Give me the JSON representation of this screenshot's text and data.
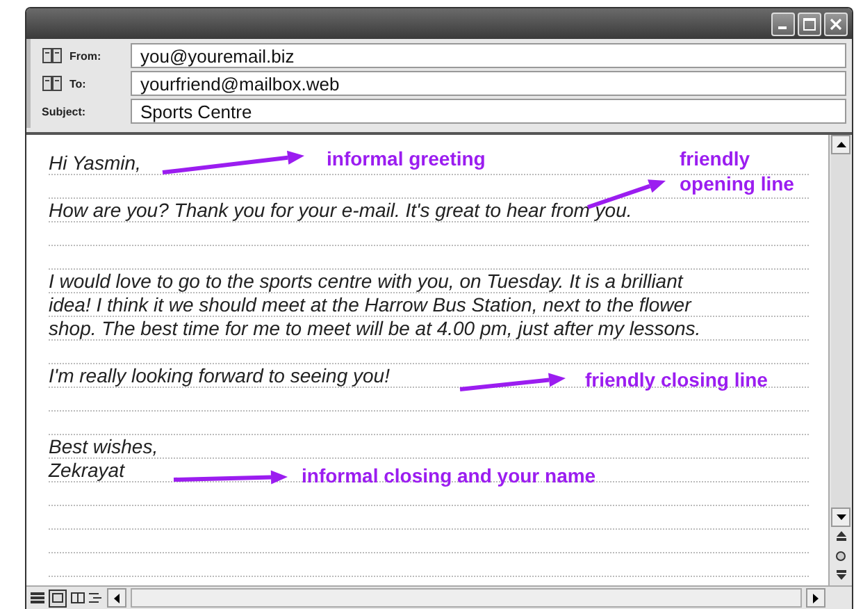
{
  "header": [
    {
      "label": "From:",
      "has_icon": true,
      "value": "you@youremail.biz"
    },
    {
      "label": "To:",
      "has_icon": true,
      "value": "yourfriend@mailbox.web"
    },
    {
      "label": "Subject:",
      "has_icon": false,
      "value": "Sports Centre"
    }
  ],
  "body_lines": [
    {
      "kind": "text",
      "text": "Hi Yasmin,"
    },
    {
      "kind": "blank"
    },
    {
      "kind": "text",
      "text": "How are you? Thank you for your e-mail. It's great to hear from you."
    },
    {
      "kind": "blank"
    },
    {
      "kind": "blank"
    },
    {
      "kind": "text",
      "text": "I would love to go to the sports centre with you, on Tuesday. It is a brilliant"
    },
    {
      "kind": "text",
      "text": "idea! I think it we should meet at the Harrow Bus Station, next to the flower"
    },
    {
      "kind": "text",
      "text": "shop. The best time for me to meet will be at 4.00 pm, just after my lessons."
    },
    {
      "kind": "blank"
    },
    {
      "kind": "text",
      "text": "I'm really looking forward to seeing you!"
    },
    {
      "kind": "blank"
    },
    {
      "kind": "blank"
    },
    {
      "kind": "text",
      "text": "Best wishes,"
    },
    {
      "kind": "text",
      "text": "Zekrayat"
    },
    {
      "kind": "blank"
    },
    {
      "kind": "blank"
    },
    {
      "kind": "blank"
    },
    {
      "kind": "blank"
    }
  ],
  "annotations": [
    {
      "text": "informal greeting"
    },
    {
      "text": "friendly opening line"
    },
    {
      "text": "friendly closing line"
    },
    {
      "text": "informal closing and your name"
    }
  ]
}
